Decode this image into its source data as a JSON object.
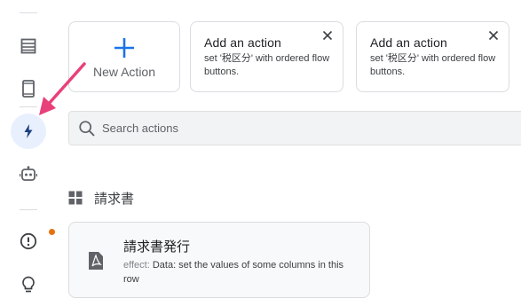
{
  "rail": {
    "items": [
      {
        "name": "table-icon",
        "active": false
      },
      {
        "name": "phone-icon",
        "active": false
      },
      {
        "name": "lightning-icon",
        "active": true
      },
      {
        "name": "bot-icon",
        "active": false
      },
      {
        "name": "alert-circle-icon",
        "active": false
      },
      {
        "name": "lightbulb-icon",
        "active": false
      }
    ],
    "notification_color": "#e8710a"
  },
  "new_action": {
    "label": "New Action",
    "accent": "#1a73e8"
  },
  "suggestions": [
    {
      "title": "Add an action",
      "desc": "set '税区分' with ordered flow buttons."
    },
    {
      "title": "Add an action",
      "desc": "set '税区分' with ordered flow buttons."
    }
  ],
  "search": {
    "placeholder": "Search actions",
    "value": ""
  },
  "section": {
    "title": "請求書"
  },
  "action": {
    "name": "請求書発行",
    "effect_key": "effect:",
    "effect_value": "Data: set the values of some columns in this row"
  },
  "annotation_color": "#e8407a"
}
